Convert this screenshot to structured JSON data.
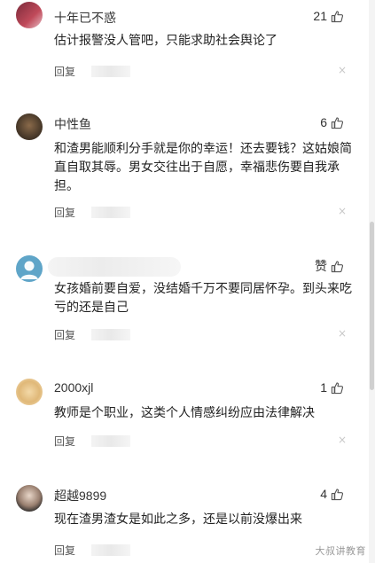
{
  "comments": [
    {
      "name": "十年已不惑",
      "likes": "21",
      "text": "估计报警没人管吧，只能求助社会舆论了",
      "reply": "回复"
    },
    {
      "name": "中性鱼",
      "likes": "6",
      "text": "和渣男能顺利分手就是你的幸运！还去要钱？这姑娘简直自取其辱。男女交往出于自愿，幸福悲伤要自我承担。",
      "reply": "回复"
    },
    {
      "name": "",
      "likes": "赞",
      "text": "女孩婚前要自爱，没结婚千万不要同居怀孕。到头来吃亏的还是自己",
      "reply": "回复"
    },
    {
      "name": "2000xjl",
      "likes": "1",
      "text": "教师是个职业，这类个人情感纠纷应由法律解决",
      "reply": "回复"
    },
    {
      "name": "超越9899",
      "likes": "4",
      "text": "现在渣男渣女是如此之多，还是以前没爆出来",
      "reply": "回复"
    }
  ],
  "close_symbol": "×",
  "icons": {
    "like": "thumbs-up-icon",
    "close": "close-icon"
  },
  "watermark": "大叔讲教育"
}
